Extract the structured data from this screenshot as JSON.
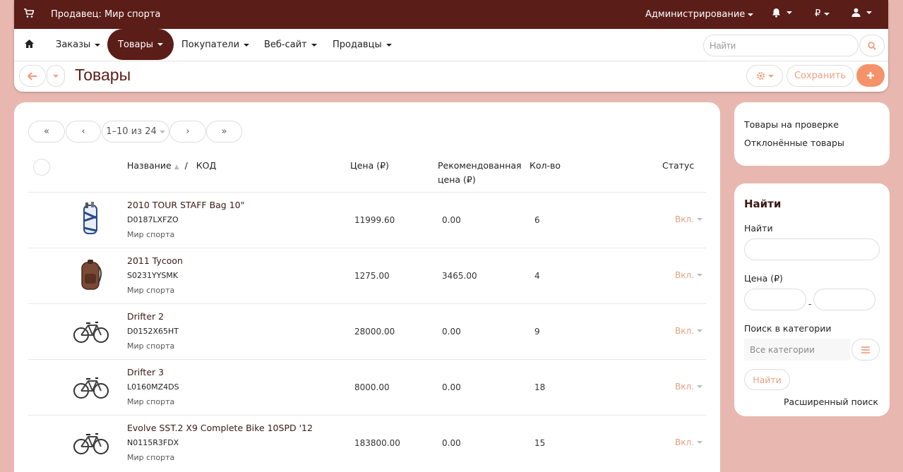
{
  "topbar": {
    "vendor": "Продавец: Мир спорта",
    "admin": "Администрирование",
    "currency": "₽"
  },
  "nav": {
    "items": [
      "Заказы",
      "Товары",
      "Покупатели",
      "Веб-сайт",
      "Продавцы"
    ],
    "active": "Товары",
    "search_placeholder": "Найти"
  },
  "toolbar": {
    "title": "Товары",
    "save_label": "Сохранить"
  },
  "pager": {
    "first": "«",
    "prev": "‹",
    "range": "1–10 из 24",
    "next": "›",
    "last": "»"
  },
  "table": {
    "headers": {
      "name": "Название",
      "code": "КОД",
      "price": "Цена (₽)",
      "rec_price_1": "Рекомендованная",
      "rec_price_2": "цена (₽)",
      "qty": "Кол-во",
      "status": "Статус"
    },
    "rows": [
      {
        "name": "2010 TOUR STAFF Bag 10\"",
        "code": "D0187LXFZO",
        "vendor": "Мир спорта",
        "price": "11999.60",
        "rec": "0.00",
        "qty": "6",
        "status": "Вкл.",
        "thumb": "golf-bag"
      },
      {
        "name": "2011 Tycoon",
        "code": "S0231YYSMK",
        "vendor": "Мир спорта",
        "price": "1275.00",
        "rec": "3465.00",
        "qty": "4",
        "status": "Вкл.",
        "thumb": "backpack"
      },
      {
        "name": "Drifter 2",
        "code": "D0152X65HT",
        "vendor": "Мир спорта",
        "price": "28000.00",
        "rec": "0.00",
        "qty": "9",
        "status": "Вкл.",
        "thumb": "bike"
      },
      {
        "name": "Drifter 3",
        "code": "L0160MZ4DS",
        "vendor": "Мир спорта",
        "price": "8000.00",
        "rec": "0.00",
        "qty": "18",
        "status": "Вкл.",
        "thumb": "bike"
      },
      {
        "name": "Evolve SST.2 X9 Complete Bike 10SPD '12",
        "code": "N0115R3FDX",
        "vendor": "Мир спорта",
        "price": "183800.00",
        "rec": "0.00",
        "qty": "15",
        "status": "Вкл.",
        "thumb": "bike"
      }
    ]
  },
  "side_links": [
    "Товары на проверке",
    "Отклонённые товары"
  ],
  "filter": {
    "title": "Найти",
    "search_label": "Найти",
    "price_label": "Цена (₽)",
    "price_dash": "-",
    "category_label": "Поиск в категории",
    "category_placeholder": "Все категории",
    "find_button": "Найти",
    "advanced": "Расширенный поиск"
  },
  "colors": {
    "brand": "#5b1d18",
    "accent": "#f5926a",
    "background": "#e8b8b0"
  }
}
